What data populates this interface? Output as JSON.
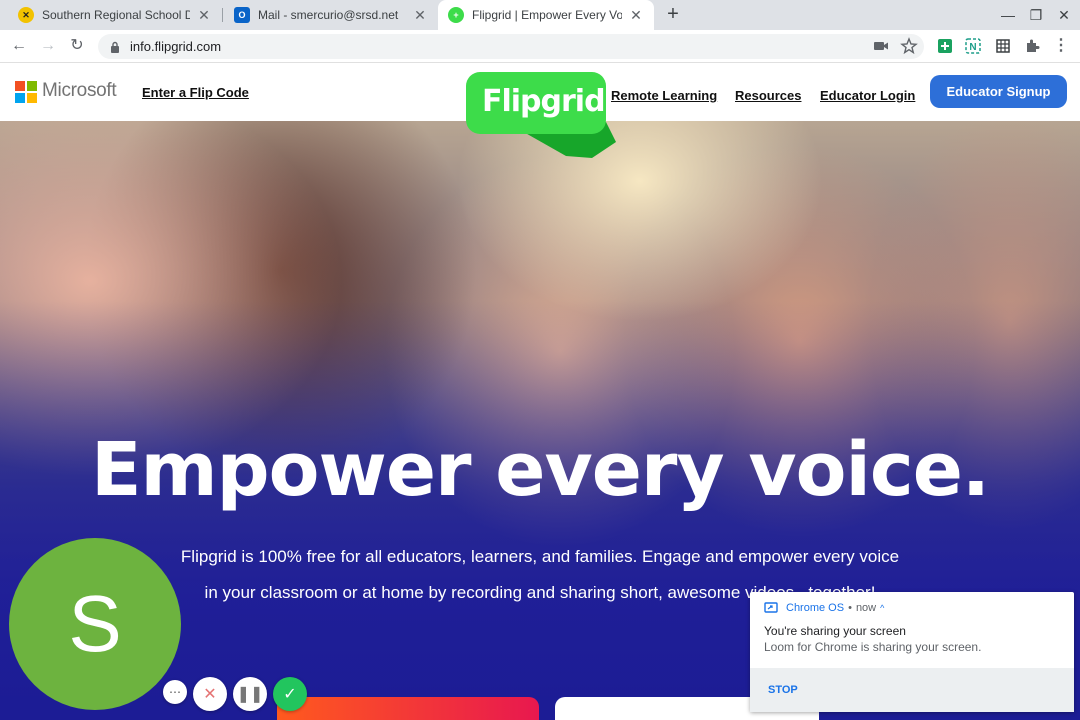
{
  "browser": {
    "tabs": [
      {
        "title": "Southern Regional School District",
        "icon": "school-logo-icon"
      },
      {
        "title": "Mail - smercurio@srsd.net",
        "icon": "outlook-icon"
      },
      {
        "title": "Flipgrid | Empower Every Voice",
        "icon": "flipgrid-icon",
        "active": true
      }
    ],
    "new_tab": "+",
    "url": "info.flipgrid.com",
    "window_controls": [
      "minimize",
      "restore",
      "close"
    ]
  },
  "site": {
    "brand": "Microsoft",
    "flip_code_link": "Enter a Flip Code",
    "logo_text": "Flipgrid",
    "nav": [
      "Remote Learning",
      "Resources",
      "Educator Login"
    ],
    "signup_button": "Educator Signup"
  },
  "hero": {
    "title": "Empower every voice.",
    "subtitle": "Flipgrid is 100% free for all educators, learners, and families. Engage and empower every voice in your classroom or at home by recording and sharing short, awesome videos...together!"
  },
  "loom": {
    "avatar_letter": "S",
    "avatar_color": "#6db33f",
    "controls": [
      "more-icon",
      "cancel-icon",
      "pause-icon",
      "done-icon"
    ]
  },
  "notification": {
    "source": "Chrome OS",
    "time": "now",
    "title": "You're sharing your screen",
    "body": "Loom for Chrome is sharing your screen.",
    "action": "STOP"
  },
  "colors": {
    "flipgrid_green": "#3ddc4a",
    "signup_blue": "#2d6fd8",
    "link_blue": "#1a73e8"
  }
}
